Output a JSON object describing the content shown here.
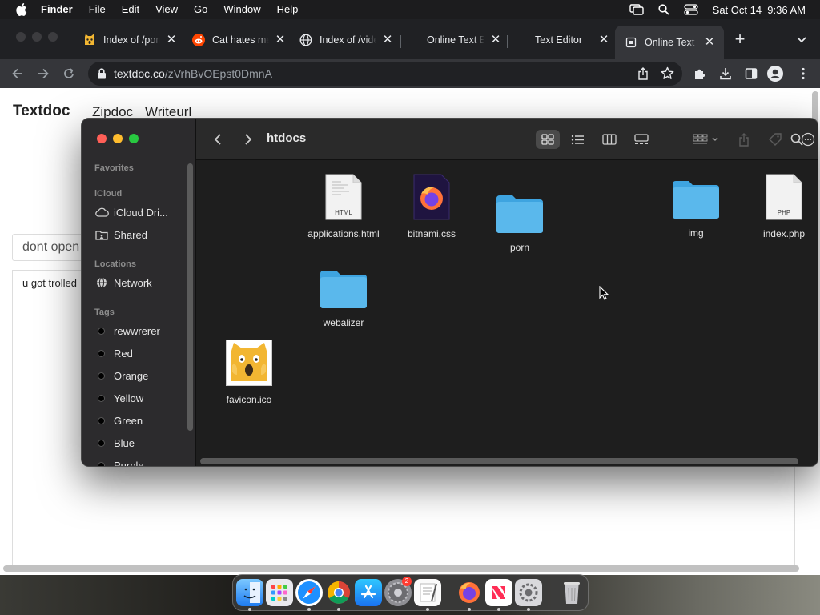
{
  "menubar": {
    "app_name": "Finder",
    "menus": [
      "File",
      "Edit",
      "View",
      "Go",
      "Window",
      "Help"
    ],
    "clock": "Sat Oct 14  9:36 AM"
  },
  "browser": {
    "tabs": [
      {
        "title": "Index of /porn",
        "icon": "cat-emoji-icon"
      },
      {
        "title": "Cat hates me",
        "icon": "reddit-icon"
      },
      {
        "title": "Index of /videos",
        "icon": "globe-icon"
      },
      {
        "title": "Online Text Editor",
        "icon": "none"
      },
      {
        "title": "Text Editor",
        "icon": "none"
      },
      {
        "title": "Online Text Editor",
        "icon": "document-icon",
        "active": true
      }
    ],
    "url_host": "textdoc.co",
    "url_path": "/zVrhBvOEpst0DmnA"
  },
  "webpage": {
    "brand": "Textdoc",
    "nav": [
      "Zipdoc",
      "Writeurl"
    ],
    "doc_title": "dont open",
    "doc_body": "u got trolled"
  },
  "finder": {
    "folder_title": "htdocs",
    "sidebar": {
      "favorites_header": "Favorites",
      "icloud_header": "iCloud",
      "icloud_items": [
        {
          "label": "iCloud Dri...",
          "icon": "cloud-icon"
        },
        {
          "label": "Shared",
          "icon": "shared-folder-icon"
        }
      ],
      "locations_header": "Locations",
      "location_items": [
        {
          "label": "Network",
          "icon": "globe-icon"
        }
      ],
      "tags_header": "Tags",
      "tags": [
        "rewwrerer",
        "Red",
        "Orange",
        "Yellow",
        "Green",
        "Blue",
        "Purple"
      ]
    },
    "files": [
      {
        "name": "applications.html",
        "kind": "html-file",
        "badge": "HTML"
      },
      {
        "name": "bitnami.css",
        "kind": "css-file"
      },
      {
        "name": "porn",
        "kind": "folder"
      },
      {
        "name": "img",
        "kind": "folder"
      },
      {
        "name": "index.php",
        "kind": "php-file",
        "badge": "PHP"
      },
      {
        "name": "webalizer",
        "kind": "folder"
      },
      {
        "name": "favicon.ico",
        "kind": "ico-file"
      }
    ]
  },
  "dock": {
    "apps": [
      "Finder",
      "Launchpad",
      "Safari",
      "Chrome",
      "App Store",
      "System Preferences",
      "TextEdit",
      "Firefox",
      "News",
      "System Settings",
      "Trash"
    ],
    "settings_badge": "2"
  },
  "colors": {
    "folder_blue": "#5ab8ec",
    "close_red": "#ff5f57",
    "minimize_yellow": "#febc2e",
    "zoom_green": "#28c840"
  }
}
